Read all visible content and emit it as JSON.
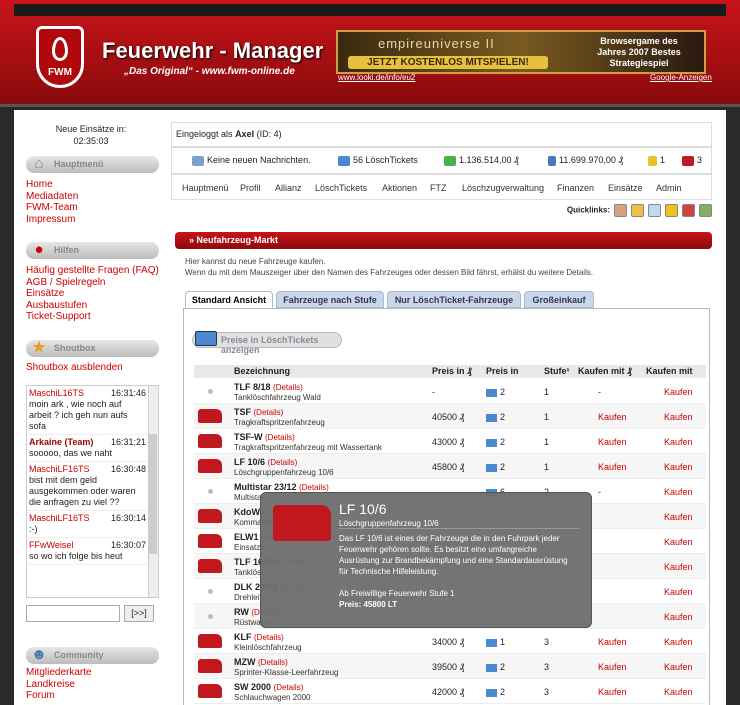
{
  "header": {
    "title": "Feuerwehr - Manager",
    "subtitle": "„Das Original“ - www.fwm-online.de",
    "logo_text": "FWM",
    "banner": {
      "brand": "empireuniverse II",
      "cta": "JETZT KOSTENLOS MITSPIELEN!",
      "right": "Browsergame des Jahres 2007 Bestes Strategiespiel",
      "link": "www.looki.de/info/eu2",
      "ads": "Google-Anzeigen"
    }
  },
  "sidebar": {
    "einsatz_label": "Neue Einsätze in:",
    "einsatz_time": "02:35:03",
    "sections": {
      "main": "Hauptmenü",
      "help": "Hilfen",
      "shoutbox": "Shoutbox",
      "community": "Community"
    },
    "main_links": [
      "Home",
      "Mediadaten",
      "FWM-Team",
      "Impressum"
    ],
    "help_links": [
      "Häufig gestellte Fragen (FAQ)",
      "AGB / Spielregeln",
      "Einsätze",
      "Ausbaustufen",
      "Ticket-Support"
    ],
    "shoutbox_toggle": "Shoutbox ausblenden",
    "messages": [
      {
        "name": "MaschiL16TS",
        "time": "16:31:46",
        "text": "moin ark , wie noch auf arbeit ? ich geh nun aufs sofa"
      },
      {
        "name": "Arkaine (Team)",
        "time": "16:31:21",
        "text": "sooooo, das we naht"
      },
      {
        "name": "MaschiLF16TS",
        "time": "16:30:48",
        "text": "bist mit dem geld ausgekommen oder waren die anfragen zu viel ??"
      },
      {
        "name": "MaschiLF16TS",
        "time": "16:30:14",
        "text": ":-)"
      },
      {
        "name": "FFwWeisel",
        "time": "16:30:07",
        "text": "so wo ich folge bis heut"
      }
    ],
    "send_label": "[>>]",
    "community_links": [
      "Mitgliederkarte",
      "Landkreise",
      "Forum"
    ]
  },
  "main": {
    "login_prefix": "Eingeloggt als",
    "user": "Axel",
    "user_id": "(ID: 4)",
    "stats": {
      "messages": "Keine neuen Nachrichten.",
      "tickets": "56 LöschTickets",
      "money": "1.136.514,00 ₰",
      "balance": "11.699.970,00 ₰",
      "rank": "1",
      "vehicles": "3"
    },
    "nav": [
      "Hauptmenü",
      "Profil",
      "Allianz",
      "LöschTickets",
      "Aktionen",
      "FTZ",
      "Löschzugverwaltung",
      "Finanzen",
      "Einsätze",
      "Admin"
    ],
    "quicklinks": "Quicklinks:",
    "panel_title": "Neufahrzeug-Markt",
    "intro": [
      "Hier kannst du neue Fahrzeuge kaufen.",
      "Wenn du mit dem Mauszeiger über den Namen des Fahrzeuges oder dessen Bild fährst, erhälst du weitere Details."
    ],
    "tabs": [
      "Standard Ansicht",
      "Fahrzeuge nach Stufe",
      "Nur LöschTicket-Fahrzeuge",
      "Großeinkauf"
    ],
    "lt_button": "Preise in LöschTickets anzeigen",
    "columns": [
      "Bezeichnung",
      "Preis in ₰",
      "Preis in",
      "Stufe¹",
      "Kaufen mit ₰",
      "Kaufen mit"
    ],
    "details": "(Details)",
    "rows": [
      {
        "name": "TLF 8/18",
        "desc": "Tanklöschfahrzeug Wald",
        "price": "-",
        "tickets": "2",
        "stufe": "1",
        "buy1": "-",
        "buy2": "Kaufen",
        "icon": "dot"
      },
      {
        "name": "TSF",
        "desc": "Tragkraftspritzenfahrzeug",
        "price": "40500 ₰",
        "tickets": "2",
        "stufe": "1",
        "buy1": "Kaufen",
        "buy2": "Kaufen",
        "icon": "truck"
      },
      {
        "name": "TSF-W",
        "desc": "Tragkraftspritzenfahrzeug mit Wassertank",
        "price": "43000 ₰",
        "tickets": "2",
        "stufe": "1",
        "buy1": "Kaufen",
        "buy2": "Kaufen",
        "icon": "truck"
      },
      {
        "name": "LF 10/6",
        "desc": "Löschgruppenfahrzeug 10/6",
        "price": "45800 ₰",
        "tickets": "2",
        "stufe": "1",
        "buy1": "Kaufen",
        "buy2": "Kaufen",
        "icon": "truck"
      },
      {
        "name": "Multistar 23/12",
        "desc": "Multistar",
        "price": "",
        "tickets": "6",
        "stufe": "2",
        "buy1": "-",
        "buy2": "Kaufen",
        "icon": "dot"
      },
      {
        "name": "KdoW",
        "desc": "Kommando",
        "price": "",
        "tickets": "",
        "stufe": "",
        "buy1": "",
        "buy2": "Kaufen",
        "icon": "truck"
      },
      {
        "name": "ELW1",
        "desc": "Einsatzleit",
        "price": "",
        "tickets": "",
        "stufe": "",
        "buy1": "",
        "buy2": "Kaufen",
        "icon": "truck"
      },
      {
        "name": "TLF 16/24",
        "desc": "Tanklösch",
        "price": "",
        "tickets": "",
        "stufe": "",
        "buy1": "",
        "buy2": "Kaufen",
        "icon": "truck"
      },
      {
        "name": "DLK 23/12",
        "desc": "Drehleiter",
        "price": "",
        "tickets": "",
        "stufe": "",
        "buy1": "",
        "buy2": "Kaufen",
        "icon": "dot"
      },
      {
        "name": "RW",
        "desc": "Rüstwagen",
        "price": "",
        "tickets": "",
        "stufe": "",
        "buy1": "",
        "buy2": "Kaufen",
        "icon": "dot"
      },
      {
        "name": "KLF",
        "desc": "Kleinlöschfahrzeug",
        "price": "34000 ₰",
        "tickets": "1",
        "stufe": "3",
        "buy1": "Kaufen",
        "buy2": "Kaufen",
        "icon": "truck"
      },
      {
        "name": "MZW",
        "desc": "Sprinter-Klasse-Leerfahrzeug",
        "price": "39500 ₰",
        "tickets": "2",
        "stufe": "3",
        "buy1": "Kaufen",
        "buy2": "Kaufen",
        "icon": "truck"
      },
      {
        "name": "SW 2000",
        "desc": "Schlauchwagen 2000",
        "price": "42000 ₰",
        "tickets": "2",
        "stufe": "3",
        "buy1": "Kaufen",
        "buy2": "Kaufen",
        "icon": "truck"
      }
    ],
    "tooltip": {
      "title": "LF 10/6",
      "subtitle": "Löschgruppenfahrzeug 10/6",
      "text": "Das LF 10/6 ist eines der Fahrzeuge die in den Fuhrpark jeder Feuerwehr gehören sollte. Es besitzt eine umfangreiche Ausrüstung zur Brandbekämpfung und eine Standardausrüstung für Technische Hilfeleistung.",
      "from": "Ab Freiwillige Feuerwehr Stufe 1",
      "price": "Preis: 45800 LT"
    }
  }
}
